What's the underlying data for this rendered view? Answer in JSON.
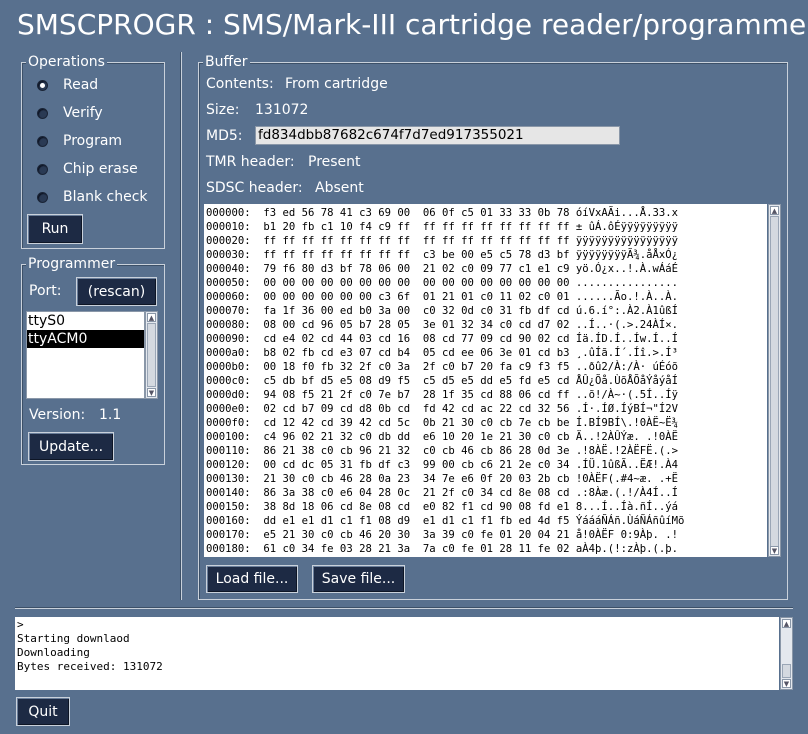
{
  "window_title": "SMSCPROGR : SMS/Mark-III cartridge reader/programmer",
  "operations": {
    "legend": "Operations",
    "options": [
      {
        "label": "Read",
        "selected": true
      },
      {
        "label": "Verify",
        "selected": false
      },
      {
        "label": "Program",
        "selected": false
      },
      {
        "label": "Chip erase",
        "selected": false
      },
      {
        "label": "Blank check",
        "selected": false
      }
    ],
    "run_label": "Run"
  },
  "programmer": {
    "legend": "Programmer",
    "port_label": "Port:",
    "rescan_label": "(rescan)",
    "ports": [
      {
        "name": "ttyS0",
        "selected": false
      },
      {
        "name": "ttyACM0",
        "selected": true
      }
    ],
    "version_label": "Version:",
    "version_value": "1.1",
    "update_label": "Update..."
  },
  "buffer": {
    "legend": "Buffer",
    "contents_label": "Contents:",
    "contents_value": "From cartridge",
    "size_label": "Size:",
    "size_value": "131072",
    "md5_label": "MD5:",
    "md5_value": "fd834dbb87682c674f7d7ed917355021",
    "tmr_label": "TMR header:",
    "tmr_value": "Present",
    "sdsc_label": "SDSC header:",
    "sdsc_value": "Absent",
    "hex_lines": [
      "000000:  f3 ed 56 78 41 c3 69 00  06 0f c5 01 33 33 0b 78 óíVxAÃi...Å.33.x",
      "000010:  b1 20 fb c1 10 f4 c9 ff  ff ff ff ff ff ff ff ff ± ûÁ.ôÉÿÿÿÿÿÿÿÿÿ",
      "000020:  ff ff ff ff ff ff ff ff  ff ff ff ff ff ff ff ff ÿÿÿÿÿÿÿÿÿÿÿÿÿÿÿÿ",
      "000030:  ff ff ff ff ff ff ff ff  c3 be 00 e5 c5 78 d3 bf ÿÿÿÿÿÿÿÿÃ¾.åÅxÓ¿",
      "000040:  79 f6 80 d3 bf 78 06 00  21 02 c0 09 77 c1 e1 c9 yö.Ó¿x..!.À.wÁáÉ",
      "000050:  00 00 00 00 00 00 00 00  00 00 00 00 00 00 00 00 ................",
      "000060:  00 00 00 00 00 00 c3 6f  01 21 01 c0 11 02 c0 01 ......Ão.!.À..À.",
      "000070:  fa 1f 36 00 ed b0 3a 00  c0 32 0d c0 31 fb df cd ú.6.í°:.À2.À1ûßÍ",
      "000080:  08 00 cd 96 05 b7 28 05  3e 01 32 34 c0 cd d7 02 ..Í..·(.>.24ÀÍ×.",
      "000090:  cd e4 02 cd 44 03 cd 16  08 cd 77 09 cd 90 02 cd Íä.ÍD.Í..Íw.Í..Í",
      "0000a0:  b8 02 fb cd e3 07 cd b4  05 cd ee 06 3e 01 cd b3 ¸.ûÍã.Í´.Íî.>.Í³",
      "0000b0:  00 18 f0 fb 32 2f c0 3a  2f c0 b7 20 fa c9 f3 f5 ..ðû2/À:/À· úÉóõ",
      "0000c0:  c5 db bf d5 e5 08 d9 f5  c5 d5 e5 dd e5 fd e5 cd ÅÛ¿Õå.ÙõÅÕåÝåýåÍ",
      "0000d0:  94 08 f5 21 2f c0 7e b7  28 1f 35 cd 88 06 cd ff ..õ!/À~·(.5Í..Íÿ",
      "0000e0:  02 cd b7 09 cd d8 0b cd  fd 42 cd ac 22 cd 32 56 .Í·.ÍØ.ÍýBÍ¬\"Í2V",
      "0000f0:  cd 12 42 cd 39 42 cd 5c  0b 21 30 c0 cb 7e cb be Í.BÍ9BÍ\\.!0ÀË~Ë¾",
      "000100:  c4 96 02 21 32 c0 db dd  e6 10 20 1e 21 30 c0 cb Ä..!2ÀÛÝæ. .!0ÀË",
      "000110:  86 21 38 c0 cb 96 21 32  c0 cb 46 cb 86 28 0d 3e .!8ÀË.!2ÀËFË.(.>",
      "000120:  00 cd dc 05 31 fb df c3  99 00 cb c6 21 2e c0 34 .ÍÜ.1ûßÃ..ËÆ!.À4",
      "000130:  21 30 c0 cb 46 28 0a 23  34 7e e6 0f 20 03 2b cb !0ÀËF(.#4~æ. .+Ë",
      "000140:  86 3a 38 c0 e6 04 28 0c  21 2f c0 34 cd 8e 08 cd .:8Àæ.(.!/À4Í..Í",
      "000150:  38 8d 18 06 cd 8e 08 cd  e0 82 f1 cd 90 08 fd e1 8...Í..Íà.ñÍ..ýá",
      "000160:  dd e1 e1 d1 c1 f1 08 d9  e1 d1 c1 f1 fb ed 4d f5 ÝáááÑÁñ.ÙáÑÁñûíMõ",
      "000170:  e5 21 30 c0 cb 46 20 30  3a 39 c0 fe 01 20 04 21 å!0ÀËF 0:9Àþ. .!",
      "000180:  61 c0 34 fe 03 28 21 3a  7a c0 fe 01 28 11 fe 02 aÀ4þ.(!:zÀþ.(.þ."
    ],
    "load_label": "Load file...",
    "save_label": "Save file..."
  },
  "console": {
    "lines": [
      ">",
      "Starting downlaod",
      "Downloading",
      "Bytes received: 131072"
    ]
  },
  "quit_label": "Quit"
}
